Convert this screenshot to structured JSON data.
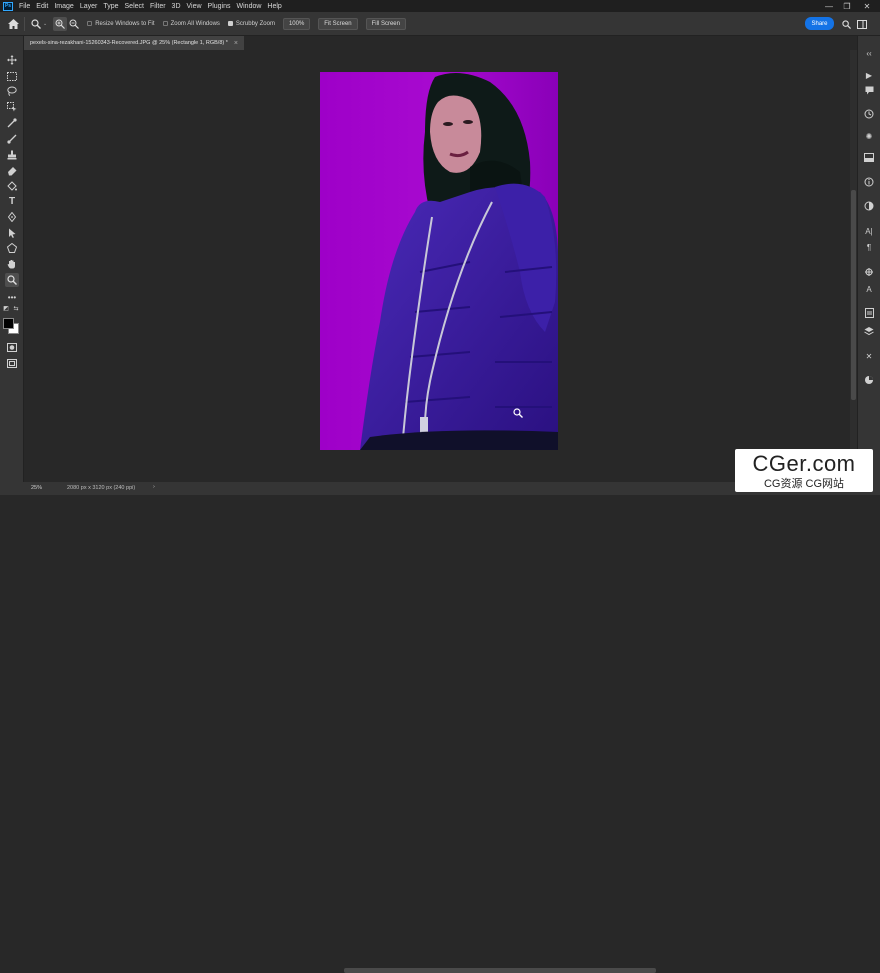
{
  "menubar": {
    "logo": "Ps",
    "items": [
      "File",
      "Edit",
      "Image",
      "Layer",
      "Type",
      "Select",
      "Filter",
      "3D",
      "View",
      "Plugins",
      "Window",
      "Help"
    ],
    "window_controls": [
      "—",
      "❐",
      "✕"
    ]
  },
  "options": {
    "resize_windows": "Resize Windows to Fit",
    "zoom_all": "Zoom All Windows",
    "scrubby_zoom": "Scrubby Zoom",
    "zoom_value": "100%",
    "fit_screen": "Fit Screen",
    "fill_screen": "Fill Screen",
    "share": "Share"
  },
  "document": {
    "tab_title": "pexels-sina-rezakhani-15260343-Recovered.JPG @ 25% (Rectangle 1, RGB/8) *",
    "close": "×"
  },
  "status": {
    "zoom": "25%",
    "doc_size": "2080 px x 3120 px (240 ppi)",
    "arrow": "›"
  },
  "watermark": {
    "title": "CGer.com",
    "subtitle": "CG资源 CG网站"
  },
  "colors": {
    "accent": "#1473e6",
    "photo_bg": "#a000cc",
    "jacket": "#3a1a9a"
  }
}
